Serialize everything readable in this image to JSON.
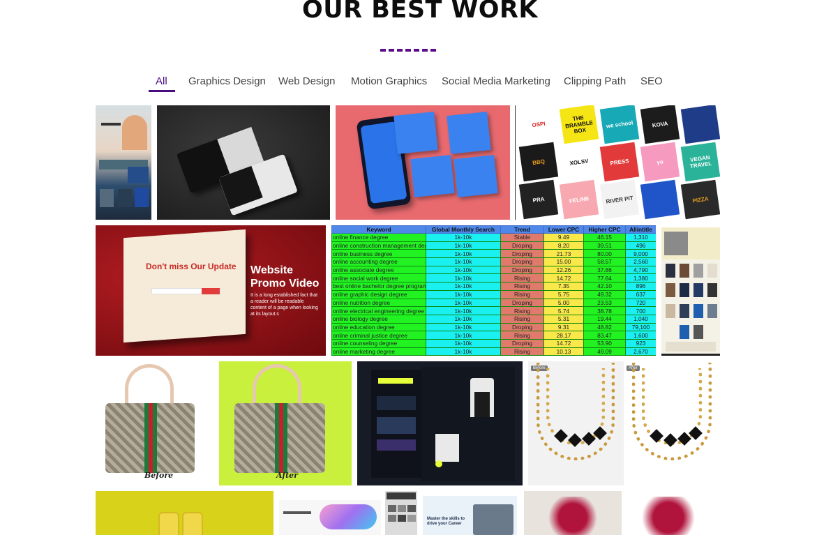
{
  "section": {
    "title": "OUR BEST WORK"
  },
  "tabs": [
    {
      "label": "All",
      "active": true
    },
    {
      "label": "Graphics Design",
      "active": false
    },
    {
      "label": "Web Design",
      "active": false
    },
    {
      "label": "Motion Graphics",
      "active": false
    },
    {
      "label": "Social Media Marketing",
      "active": false
    },
    {
      "label": "Clipping Path",
      "active": false
    },
    {
      "label": "SEO",
      "active": false
    }
  ],
  "colors": {
    "accent": "#4b0b80",
    "title": "#0d0d0d"
  },
  "promo": {
    "headline": "Don't miss Our Update",
    "title_line1": "Website",
    "title_line2": "Promo Video",
    "description": "It is a long established fact that a reader will be readable content of a page when looking at its layout.s"
  },
  "seo_table": {
    "headers": [
      "Keyword",
      "Global Monthly Search",
      "Trend",
      "Lower CPC",
      "Higher CPC",
      "Allintitle"
    ],
    "rows": [
      [
        "online finance degree",
        "1k-10k",
        "Stable",
        "9.49",
        "46.15",
        "1,310"
      ],
      [
        "online construction management degree",
        "1k-10k",
        "Droping",
        "8.20",
        "39.51",
        "496"
      ],
      [
        "online business degree",
        "1k-10k",
        "Droping",
        "21.73",
        "80.00",
        "9,000"
      ],
      [
        "online accounting degree",
        "1k-10k",
        "Droping",
        "15.00",
        "58.57",
        "2,560"
      ],
      [
        "online associate degree",
        "1k-10k",
        "Droping",
        "12.26",
        "37.86",
        "4,790"
      ],
      [
        "online social work degree",
        "1k-10k",
        "Rising",
        "14.72",
        "77.64",
        "1,380"
      ],
      [
        "best online bachelor degree programs",
        "1k-10k",
        "Rising",
        "7.35",
        "42.10",
        "896"
      ],
      [
        "online graphic design degree",
        "1k-10k",
        "Rising",
        "5.75",
        "49.32",
        "637"
      ],
      [
        "online nutrition degree",
        "1k-10k",
        "Droping",
        "5.00",
        "23.53",
        "720"
      ],
      [
        "online electrical engineering degree",
        "1k-10k",
        "Rising",
        "5.74",
        "38.78",
        "700"
      ],
      [
        "online biology degree",
        "1k-10k",
        "Rising",
        "5.31",
        "19.44",
        "1,040"
      ],
      [
        "online education degree",
        "1k-10k",
        "Droping",
        "9.31",
        "48.82",
        "79,100"
      ],
      [
        "online criminal justice degree",
        "1k-10k",
        "Rising",
        "28.17",
        "83.47",
        "1,600"
      ],
      [
        "online counseling degree",
        "1k-10k",
        "Droping",
        "14.72",
        "53.90",
        "923"
      ],
      [
        "online marketing degree",
        "1k-10k",
        "Rising",
        "10.13",
        "49.09",
        "2,670"
      ]
    ]
  },
  "clipping": {
    "before_label": "Before",
    "after_label": "After"
  },
  "necklace": {
    "before_tag": "Before",
    "after_tag": "After"
  },
  "logos": [
    {
      "text": "OSPI",
      "color": "#ffffff",
      "fg": "#e02020"
    },
    {
      "text": "THE BRAMBLE BOX",
      "color": "#f5e514",
      "fg": "#111111"
    },
    {
      "text": "we school",
      "color": "#18a9b6",
      "fg": "#ffffff"
    },
    {
      "text": "KOVA",
      "color": "#1c1c1c",
      "fg": "#ffffff"
    },
    {
      "text": "",
      "color": "#1f3c88",
      "fg": "#ffffff"
    },
    {
      "text": "BBQ",
      "color": "#1a1a1a",
      "fg": "#f0a020"
    },
    {
      "text": "XOLSV",
      "color": "#ffffff",
      "fg": "#111111"
    },
    {
      "text": "PRESS",
      "color": "#e23a3a",
      "fg": "#ffffff"
    },
    {
      "text": "yo",
      "color": "#f79ac0",
      "fg": "#ffffff"
    },
    {
      "text": "VEGAN TRAVEL",
      "color": "#2bb39a",
      "fg": "#ffffff"
    },
    {
      "text": "PRA",
      "color": "#222222",
      "fg": "#ffffff"
    },
    {
      "text": "FELINE",
      "color": "#f7a8b0",
      "fg": "#ffffff"
    },
    {
      "text": "RIVER PIT",
      "color": "#f2f2f2",
      "fg": "#333333"
    },
    {
      "text": "",
      "color": "#1f55c9",
      "fg": "#ffffff"
    },
    {
      "text": "PIZZA",
      "color": "#2a2a2a",
      "fg": "#e8a020"
    }
  ],
  "web3": {
    "headline": "Master the skills to drive your Career"
  }
}
